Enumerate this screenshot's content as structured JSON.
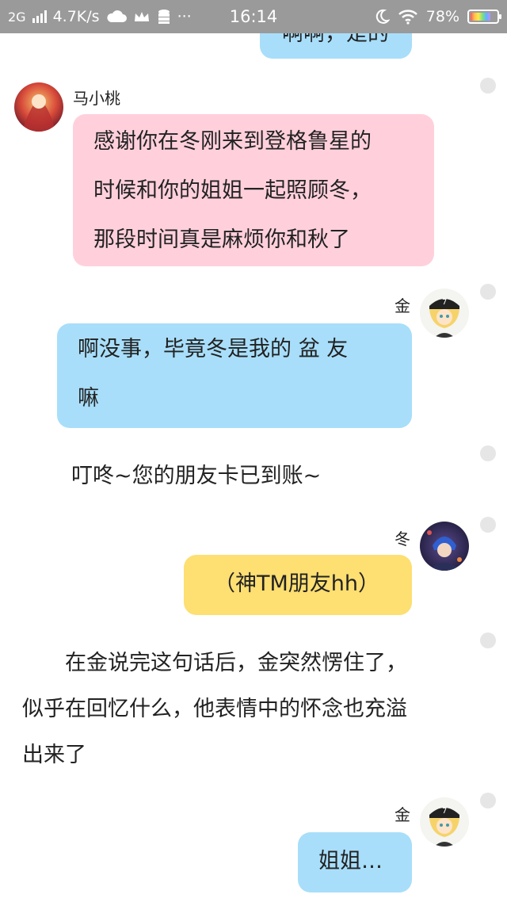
{
  "status_bar": {
    "network": "2G",
    "speed": "4.7K/s",
    "more": "···",
    "time": "16:14",
    "battery": "78%",
    "battery_level": 0.78
  },
  "messages": {
    "top_partial": "啊啊，是的",
    "m1_name": "马小桃",
    "m1_lines": [
      "感谢你在冬刚来到登格鲁星的",
      "时候和你的姐姐一起照顾冬，",
      "那段时间真是麻烦你和秋了"
    ],
    "m2_name": "金",
    "m2_lines": [
      "啊没事，毕竟冬是我的 盆 友",
      "嘛"
    ],
    "narration1": "叮咚~您的朋友卡已到账~",
    "m3_name": "冬",
    "m3_text": "（神TM朋友hh）",
    "narration2_lines": [
      "　　在金说完这句话后，金突然愣住了，",
      "似乎在回忆什么，他表情中的怀念也充溢",
      "出来了"
    ],
    "m4_name": "金",
    "m4_text": "姐姐…"
  },
  "colors": {
    "pink_bubble": "#ffd0dc",
    "blue_bubble": "#a8defa",
    "yellow_bubble": "#fddf72",
    "status_bar": "#9a9a9a"
  },
  "icons": [
    "signal-icon",
    "cloud-icon",
    "crown-icon",
    "database-icon",
    "moon-icon",
    "wifi-icon",
    "battery-icon"
  ]
}
